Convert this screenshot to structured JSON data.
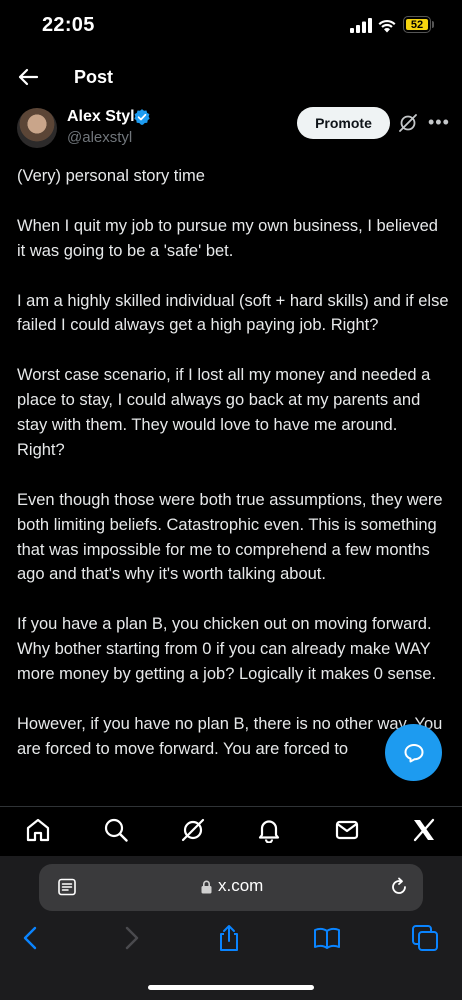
{
  "status_bar": {
    "time": "22:05",
    "battery": "52"
  },
  "header": {
    "title": "Post"
  },
  "author": {
    "name": "Alex Styl",
    "handle": "@alexstyl",
    "verified": true
  },
  "actions": {
    "promote_label": "Promote"
  },
  "post": {
    "paragraphs": [
      "(Very) personal story time",
      "When I quit my job to pursue my own business, I believed it was going to be a 'safe' bet.",
      "I am a highly skilled individual (soft + hard skills) and if else failed I could always get a high paying job. Right?",
      "Worst case scenario, if I lost all my money and needed a place to stay, I could always go back at my parents and stay with them. They would love to have me around. Right?",
      "Even though those were both true assumptions, they were both limiting beliefs. Catastrophic even. This is something that was impossible for me to comprehend a few months ago and that's why it's worth talking about.",
      "If you have a plan B, you chicken out on moving forward. Why bother starting from 0 if you can already make WAY more money by getting a job? Logically it makes 0 sense.",
      "However, if you have no plan B, there is no other way. You are forced to move forward. You are forced to"
    ]
  },
  "bottom_nav": [
    "home-icon",
    "search-icon",
    "grok-icon",
    "notifications-icon",
    "messages-icon",
    "x-logo-icon"
  ],
  "browser": {
    "url": "x.com"
  },
  "colors": {
    "accent": "#1d9bf0",
    "background": "#000000",
    "battery": "#f5d40f"
  }
}
